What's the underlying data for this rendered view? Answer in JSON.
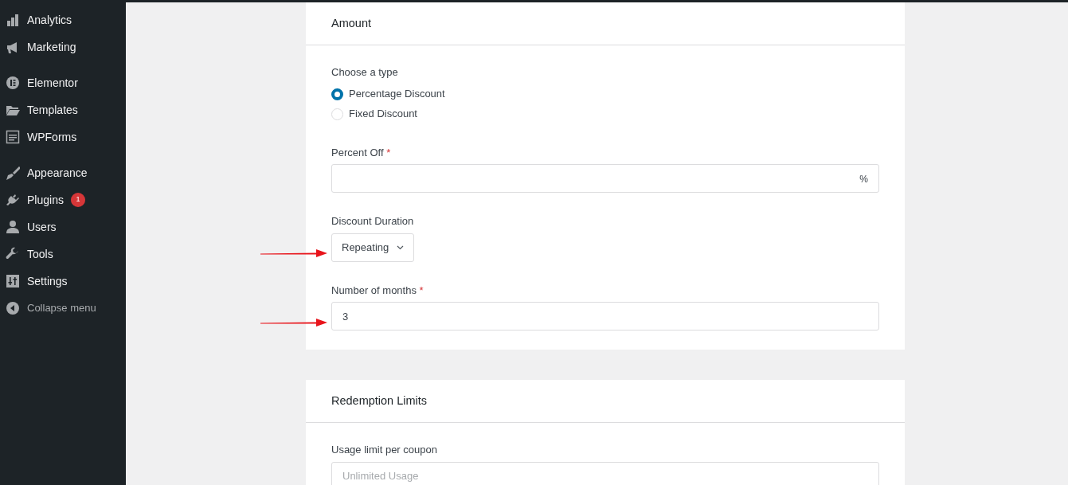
{
  "sidebar": {
    "groups": [
      [
        {
          "label": "Analytics",
          "kind": "chart"
        },
        {
          "label": "Marketing",
          "kind": "megaphone"
        }
      ],
      [
        {
          "label": "Elementor",
          "kind": "elementor"
        },
        {
          "label": "Templates",
          "kind": "folder"
        },
        {
          "label": "WPForms",
          "kind": "form"
        }
      ],
      [
        {
          "label": "Appearance",
          "kind": "brush"
        },
        {
          "label": "Plugins",
          "kind": "plug",
          "badge": "1"
        },
        {
          "label": "Users",
          "kind": "user"
        },
        {
          "label": "Tools",
          "kind": "wrench"
        },
        {
          "label": "Settings",
          "kind": "sliders"
        },
        {
          "label": "Collapse menu",
          "kind": "collapse"
        }
      ]
    ]
  },
  "cards": [
    {
      "title": "Amount",
      "fields": [
        {
          "kind": "radio",
          "label": "Choose a type",
          "options": [
            {
              "label": "Percentage Discount",
              "selected": true
            },
            {
              "label": "Fixed Discount",
              "selected": false
            }
          ]
        },
        {
          "kind": "input",
          "label": "Percent Off",
          "required_mark": "*",
          "suffix": "%",
          "arrow": false
        },
        {
          "kind": "select",
          "label": "Discount Duration",
          "value": "Repeating",
          "arrow": true
        },
        {
          "kind": "input",
          "label": "Number of months",
          "required_mark": "*",
          "value": "3",
          "arrow": true
        }
      ]
    },
    {
      "title": "Redemption Limits",
      "fields": [
        {
          "kind": "input",
          "label": "Usage limit per coupon",
          "placeholder": "Unlimited Usage",
          "arrow": false
        }
      ]
    }
  ]
}
